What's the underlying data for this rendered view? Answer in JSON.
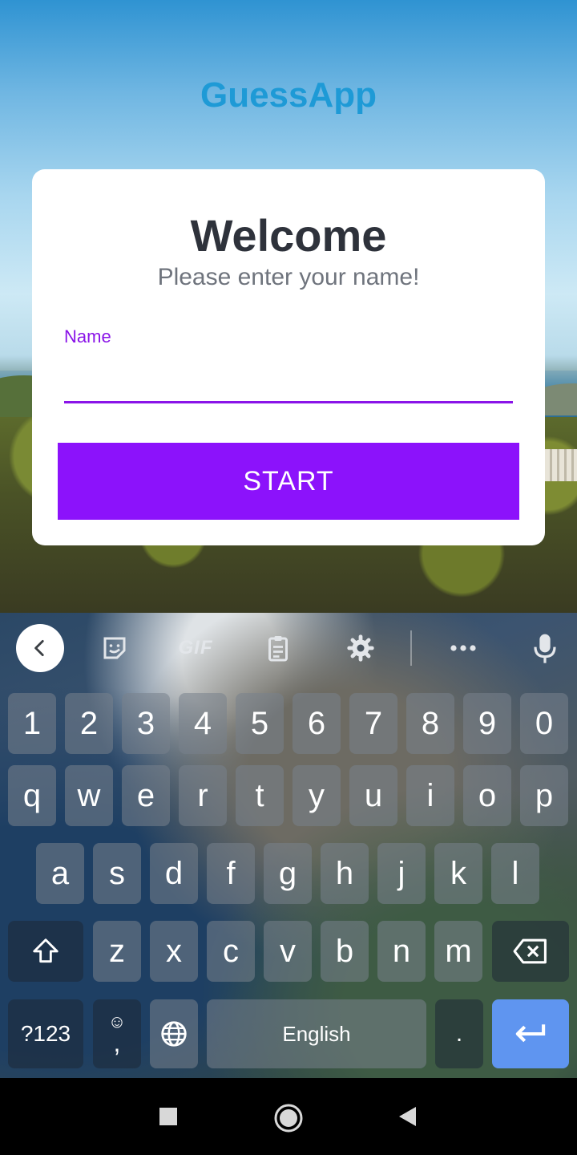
{
  "app": {
    "title": "GuessApp",
    "card": {
      "title": "Welcome",
      "subtitle": "Please enter your name!",
      "name_label": "Name",
      "name_value": "",
      "start_label": "START"
    },
    "colors": {
      "title": "#1e9ad6",
      "accent": "#8c12fb",
      "card_text": "#2e323b"
    }
  },
  "keyboard": {
    "toolbar": {
      "gif_label": "GIF",
      "icons": [
        "chevron-left-icon",
        "sticker-icon",
        "gif-icon",
        "clipboard-icon",
        "gear-icon",
        "more-icon",
        "microphone-icon"
      ]
    },
    "rows": {
      "numbers": [
        "1",
        "2",
        "3",
        "4",
        "5",
        "6",
        "7",
        "8",
        "9",
        "0"
      ],
      "row1": [
        "q",
        "w",
        "e",
        "r",
        "t",
        "y",
        "u",
        "i",
        "o",
        "p"
      ],
      "row2": [
        "a",
        "s",
        "d",
        "f",
        "g",
        "h",
        "j",
        "k",
        "l"
      ],
      "row3": [
        "z",
        "x",
        "c",
        "v",
        "b",
        "n",
        "m"
      ]
    },
    "symbols_label": "?123",
    "comma_label": ",",
    "emoji_label": "☺",
    "space_label": "English",
    "period_label": ".",
    "enter_color": "#5f95f0"
  },
  "navbar": {
    "icons": [
      "recents-icon",
      "home-icon",
      "back-icon"
    ]
  }
}
